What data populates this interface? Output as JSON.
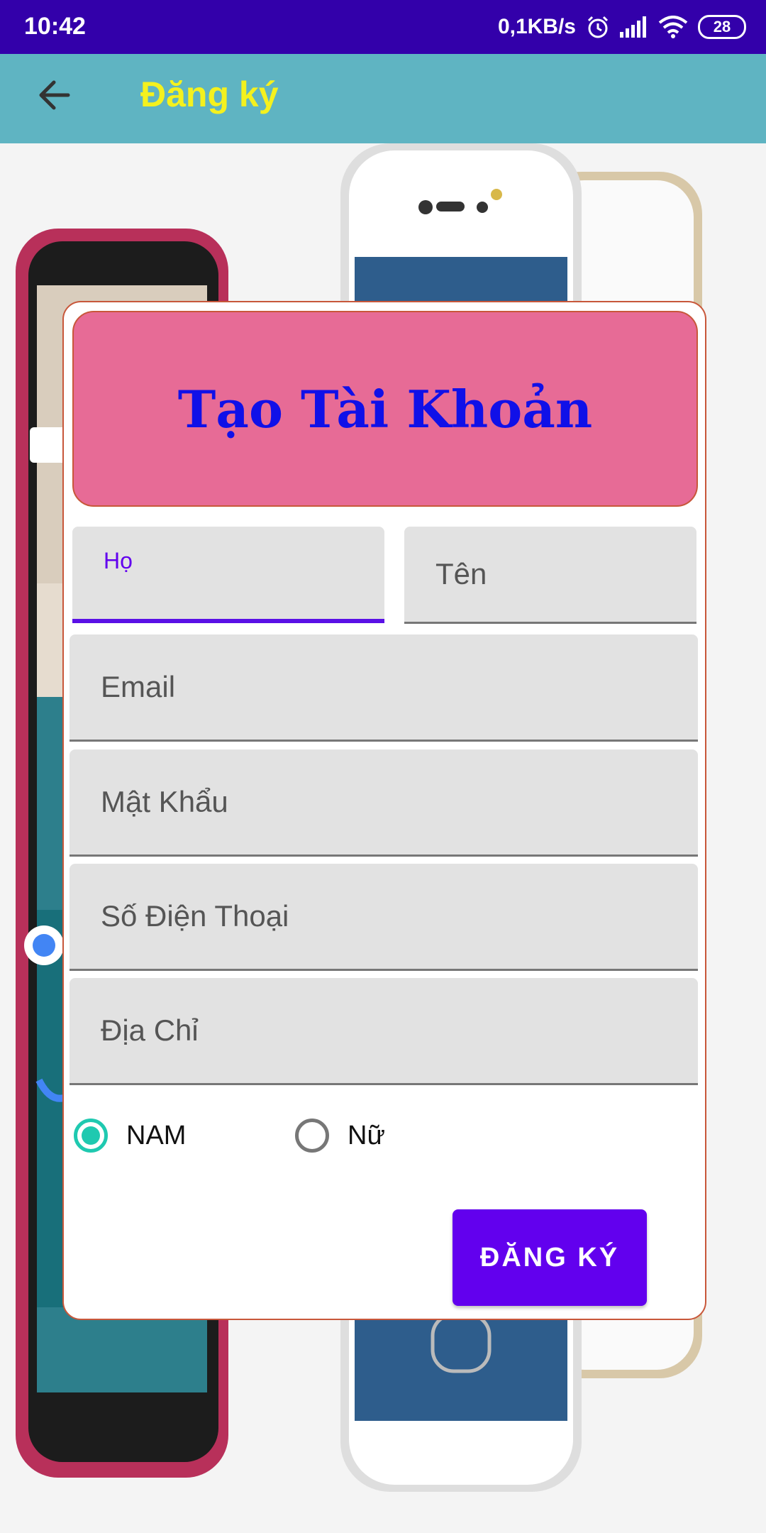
{
  "status_bar": {
    "time": "10:42",
    "network_speed": "0,1KB/s",
    "battery": "28",
    "icons": [
      "alarm-icon",
      "signal-icon",
      "wifi-icon",
      "battery-icon"
    ]
  },
  "app_bar": {
    "title": "Đăng ký",
    "back_icon": "arrow-left-icon"
  },
  "form": {
    "title": "Tạo Tài Khoản",
    "fields": {
      "last_name": "Họ",
      "first_name": "Tên",
      "email": "Email",
      "password": "Mật Khẩu",
      "phone": "Số Điện Thoại",
      "address": "Địa Chỉ"
    },
    "gender": {
      "options": [
        "NAM",
        "Nữ"
      ],
      "selected": "NAM"
    },
    "submit_label": "ĐĂNG KÝ"
  },
  "colors": {
    "status_bar": "#3300aa",
    "app_bar": "#5fb4c2",
    "title_accent": "#f4f11e",
    "header_box": "#e76b96",
    "header_text": "#1010e8",
    "primary": "#6200ee",
    "radio_checked": "#1fc9b0"
  }
}
